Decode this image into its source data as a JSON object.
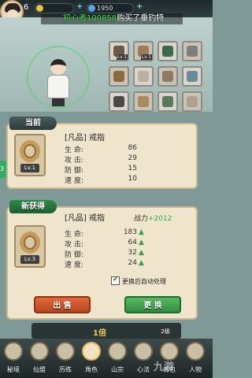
{
  "top": {
    "level": "6",
    "currency1": "",
    "currency2": "1950",
    "broadcast_name": "初心者100858",
    "broadcast_text": "购买了垂钓特"
  },
  "slots": [
    {
      "badge": "Lv.1"
    },
    {
      "badge": "Lv.1"
    },
    {
      "badge": ""
    },
    {
      "badge": ""
    },
    {
      "badge": ""
    },
    {
      "badge": ""
    },
    {
      "badge": ""
    },
    {
      "badge": ""
    },
    {
      "badge": ""
    },
    {
      "badge": ""
    },
    {
      "badge": ""
    },
    {
      "badge": ""
    }
  ],
  "current": {
    "header": "当前",
    "quality": "[凡品]",
    "name": "戒指",
    "item_level": "Lv.1",
    "stats": [
      {
        "label": "生 命:",
        "value": "86"
      },
      {
        "label": "攻 击:",
        "value": "29"
      },
      {
        "label": "防 御:",
        "value": "15"
      },
      {
        "label": "速 度:",
        "value": "10"
      }
    ]
  },
  "new_item": {
    "header": "新获得",
    "quality": "[凡品]",
    "name": "戒指",
    "item_level": "Lv.3",
    "power_label": "战力",
    "power_value": "+2012",
    "stats": [
      {
        "label": "生 命:",
        "value": "183"
      },
      {
        "label": "攻 击:",
        "value": "64"
      },
      {
        "label": "防 御:",
        "value": "32"
      },
      {
        "label": "速 度:",
        "value": "24"
      }
    ]
  },
  "auto_process_label": "更换后自动处理",
  "auto_process_checked": true,
  "sell_label": "出 售",
  "swap_label": "更 换",
  "speed_label": "1倍",
  "level_circle": "2级",
  "nav": [
    {
      "label": "秘境"
    },
    {
      "label": "仙盟"
    },
    {
      "label": "历练"
    },
    {
      "label": "角色"
    },
    {
      "label": "山宗"
    },
    {
      "label": "心法"
    },
    {
      "label": "背包"
    },
    {
      "label": "人物"
    }
  ],
  "watermark": "九游"
}
